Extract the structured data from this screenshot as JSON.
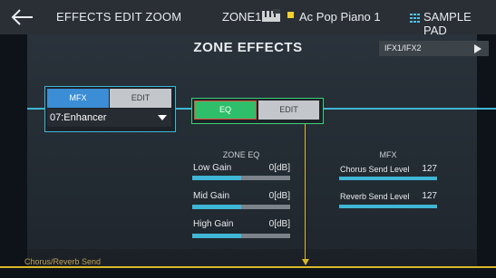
{
  "header": {
    "title": "EFFECTS EDIT ZOOM",
    "zone": "ZONE1",
    "tone_name": "Ac Pop Piano 1",
    "pad_label": "SAMPLE PAD"
  },
  "page_title": "ZONE EFFECTS",
  "ifx_selector": {
    "label": "IFX1/IFX2"
  },
  "mfx_block": {
    "tab_label": "MFX",
    "edit_label": "EDIT",
    "selected_type": "07:Enhancer"
  },
  "eq_block": {
    "tab_label": "EQ",
    "edit_label": "EDIT"
  },
  "zone_eq": {
    "title": "ZONE EQ",
    "params": [
      {
        "label": "Low Gain",
        "value": "0[dB]",
        "level": 0.5
      },
      {
        "label": "Mid Gain",
        "value": "0[dB]",
        "level": 0.5
      },
      {
        "label": "High Gain",
        "value": "0[dB]",
        "level": 0.5
      }
    ]
  },
  "mfx_sends": {
    "title": "MFX",
    "params": [
      {
        "label": "Chorus Send Level",
        "value": "127",
        "level": 1.0
      },
      {
        "label": "Reverb Send Level",
        "value": "127",
        "level": 1.0
      }
    ]
  },
  "footer": {
    "chorus_reverb_label": "Chorus/Reverb Send"
  },
  "colors": {
    "mfx_accent": "#3b8ed6",
    "eq_accent": "#2fbf6a",
    "signal_line": "#3fb6d6",
    "send_line": "#d9b92a"
  }
}
